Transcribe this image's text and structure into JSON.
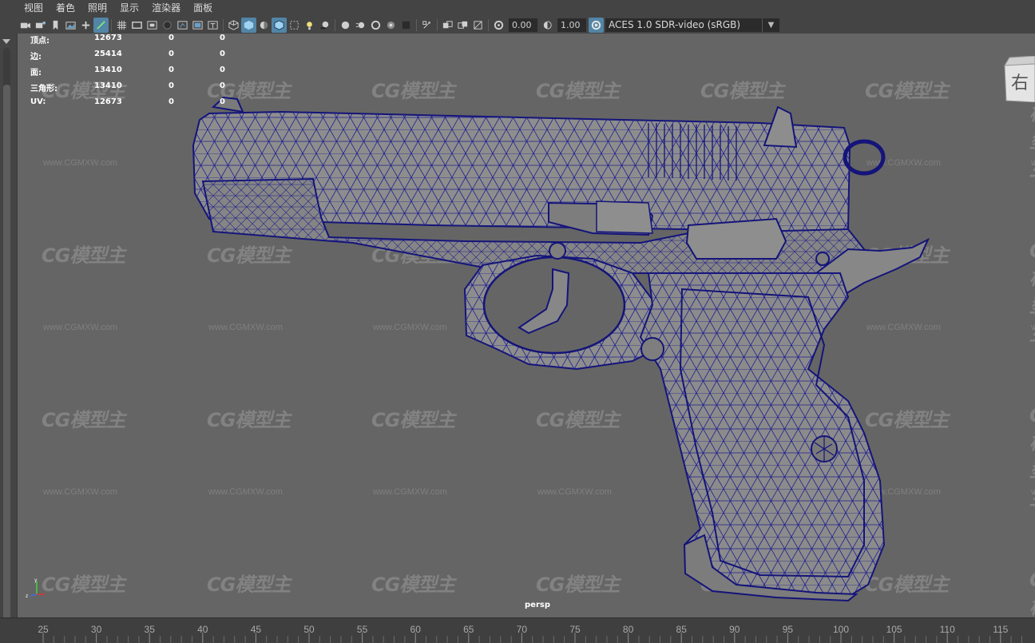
{
  "menu": [
    "视图",
    "着色",
    "照明",
    "显示",
    "渲染器",
    "面板"
  ],
  "toolbar": {
    "icons": [
      "select-camera-icon",
      "camera-attributes-icon",
      "bookmark-icon",
      "image-plane-icon",
      "2d-pan-zoom-icon",
      "grease-pencil-icon",
      "grid-icon",
      "film-gate-icon",
      "resolution-gate-icon",
      "gate-mask-icon",
      "field-chart-icon",
      "safe-action-icon",
      "safe-title-icon",
      "wireframe-icon",
      "smooth-shade-icon",
      "default-material-icon",
      "wireframe-on-shaded-icon",
      "xray-icon",
      "use-all-lights-icon",
      "shadows-icon",
      "ambient-occlusion-icon",
      "motion-blur-icon",
      "anti-aliasing-icon",
      "depth-of-field-icon",
      "isolate-select-icon",
      "xray-joints-icon",
      "xray-active-icon",
      "backface-culling-icon",
      "exposure-icon",
      "gamma-icon",
      "color-management-icon"
    ],
    "exposure_value": "0.00",
    "gamma_value": "1.00",
    "color_space": "ACES 1.0 SDR-video (sRGB)"
  },
  "hud": {
    "rows": [
      {
        "label": "顶点:",
        "v1": "12673",
        "v2": "0",
        "v3": "0"
      },
      {
        "label": "边:",
        "v1": "25414",
        "v2": "0",
        "v3": "0"
      },
      {
        "label": "面:",
        "v1": "13410",
        "v2": "0",
        "v3": "0"
      },
      {
        "label": "三角形:",
        "v1": "13410",
        "v2": "0",
        "v3": "0"
      },
      {
        "label": "UV:",
        "v1": "12673",
        "v2": "0",
        "v3": "0"
      }
    ]
  },
  "viewcube_label": "右",
  "camera_label": "persp",
  "watermark": {
    "logo": "CG模型主",
    "url": "www.CGMXW.com"
  },
  "timeline": {
    "ticks": [
      "25",
      "30",
      "35",
      "40",
      "45",
      "50",
      "55",
      "60",
      "65",
      "70",
      "75",
      "80",
      "85",
      "90",
      "95",
      "100",
      "105",
      "110",
      "115"
    ]
  },
  "colors": {
    "viewport_bg": "#656565",
    "wireframe": "#1a1a8a",
    "accent": "#5285a6"
  }
}
